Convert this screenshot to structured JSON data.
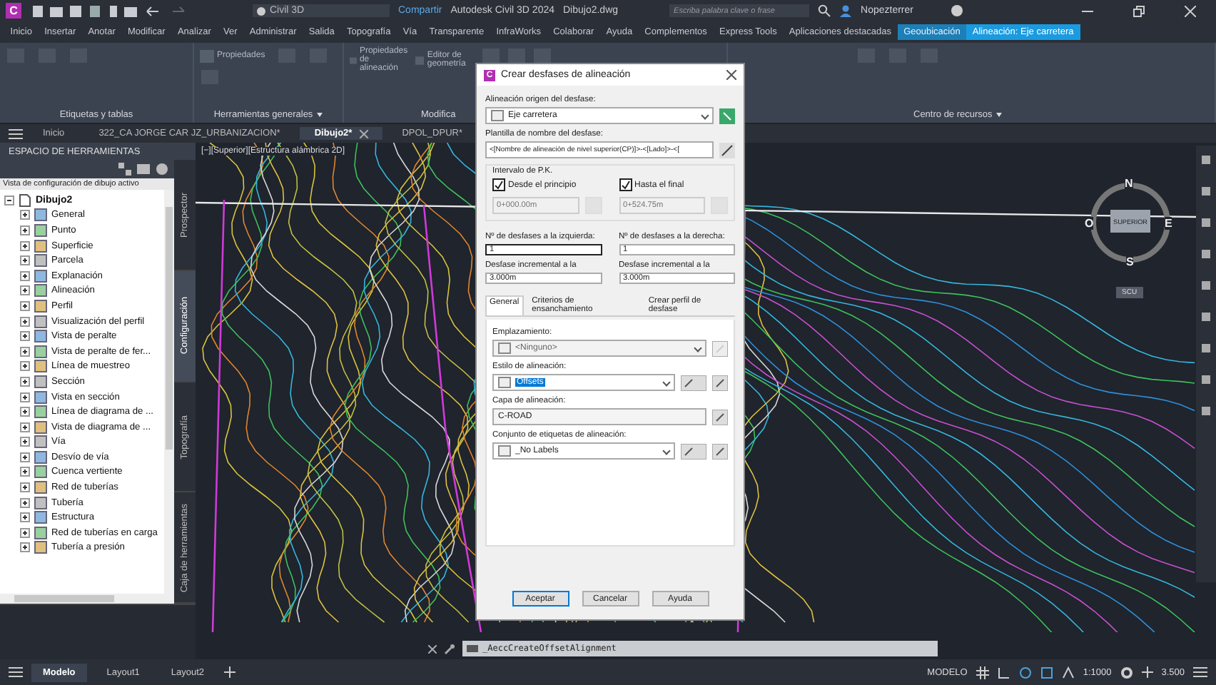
{
  "title_bar": {
    "app_letter": "C",
    "workspace": "Civil 3D",
    "share": "Compartir",
    "app_title": "Autodesk Civil 3D 2024",
    "file": "Dibujo2.dwg",
    "search": {
      "placeholder": "Escriba palabra clave o frase"
    },
    "user": "Nopezterrer"
  },
  "menu_tabs": [
    {
      "label": "Inicio",
      "kind": "normal",
      "selected": false
    },
    {
      "label": "Insertar",
      "kind": "normal",
      "selected": false
    },
    {
      "label": "Anotar",
      "kind": "normal",
      "selected": false
    },
    {
      "label": "Modificar",
      "kind": "normal",
      "selected": false
    },
    {
      "label": "Analizar",
      "kind": "normal",
      "selected": false
    },
    {
      "label": "Ver",
      "kind": "normal",
      "selected": false
    },
    {
      "label": "Administrar",
      "kind": "normal",
      "selected": false
    },
    {
      "label": "Salida",
      "kind": "normal",
      "selected": false
    },
    {
      "label": "Topografía",
      "kind": "normal",
      "selected": false
    },
    {
      "label": "Vía",
      "kind": "normal",
      "selected": false
    },
    {
      "label": "Transparente",
      "kind": "normal",
      "selected": false
    },
    {
      "label": "InfraWorks",
      "kind": "normal",
      "selected": false
    },
    {
      "label": "Colaborar",
      "kind": "normal",
      "selected": false
    },
    {
      "label": "Ayuda",
      "kind": "normal",
      "selected": false
    },
    {
      "label": "Complementos",
      "kind": "normal",
      "selected": false
    },
    {
      "label": "Express Tools",
      "kind": "normal",
      "selected": false
    },
    {
      "label": "Aplicaciones destacadas",
      "kind": "normal",
      "selected": false
    },
    {
      "label": "Geoubicación",
      "kind": "contextual",
      "selected": false
    },
    {
      "label": "Alineación: Eje carretera",
      "kind": "contextual",
      "selected": true
    }
  ],
  "ribbon": {
    "panels": [
      {
        "label": "Etiquetas y tablas",
        "menu": false
      },
      {
        "label": "Herramientas generales",
        "menu": true,
        "buttons": [
          "Propiedades"
        ]
      },
      {
        "label": "Modifica",
        "menu": false,
        "buttons": [
          "Propiedades de alineación",
          "Editor de geometría"
        ]
      },
      {
        "label": "Centro de recursos",
        "menu": true
      }
    ]
  },
  "doc_tabs": [
    {
      "label": "Inicio",
      "selected": false
    },
    {
      "label": "322_CA JORGE CAR JZ_URBANIZACION*",
      "selected": false
    },
    {
      "label": "Dibujo2*",
      "selected": true
    },
    {
      "label": "DPOL_DPUR*",
      "selected": false
    }
  ],
  "palette": {
    "title": "ESPACIO DE HERRAMIENTAS",
    "view": "Vista de configuración de dibujo activo",
    "tree": {
      "label": "Dibujo2",
      "expanded": true,
      "children": [
        {
          "label": "General",
          "expanded": false
        },
        {
          "label": "Punto",
          "expanded": false
        },
        {
          "label": "Superficie",
          "expanded": false
        },
        {
          "label": "Parcela",
          "expanded": false
        },
        {
          "label": "Explanación",
          "expanded": false
        },
        {
          "label": "Alineación",
          "expanded": false
        },
        {
          "label": "Perfil",
          "expanded": false
        },
        {
          "label": "Visualización del perfil",
          "expanded": false
        },
        {
          "label": "Vista de peralte",
          "expanded": false
        },
        {
          "label": "Vista de peralte de fer...",
          "expanded": false
        },
        {
          "label": "Línea de muestreo",
          "expanded": false
        },
        {
          "label": "Sección",
          "expanded": false
        },
        {
          "label": "Vista en sección",
          "expanded": false
        },
        {
          "label": "Línea de diagrama de ...",
          "expanded": false
        },
        {
          "label": "Vista de diagrama de ...",
          "expanded": false
        },
        {
          "label": "Vía",
          "expanded": false
        },
        {
          "label": "Desvío de vía",
          "expanded": false
        },
        {
          "label": "Cuenca vertiente",
          "expanded": false
        },
        {
          "label": "Red de tuberías",
          "expanded": false
        },
        {
          "label": "Tubería",
          "expanded": false
        },
        {
          "label": "Estructura",
          "expanded": false
        },
        {
          "label": "Red de tuberías en carga",
          "expanded": false
        },
        {
          "label": "Tubería a presión",
          "expanded": false
        }
      ]
    },
    "side_tabs": [
      {
        "label": "Prospector",
        "selected": false
      },
      {
        "label": "Configuración",
        "selected": true
      },
      {
        "label": "Topografía",
        "selected": false
      },
      {
        "label": "Caja de herramientas",
        "selected": false
      }
    ]
  },
  "viewport": {
    "label": "[−][Superior][Estructura alámbrica 2D]",
    "compass": {
      "north": "N",
      "south": "S",
      "east": "E",
      "west": "O",
      "cube": "SUPERIOR",
      "ucs": "SCU"
    },
    "command": "_AeccCreateOffsetAlignment"
  },
  "dialog": {
    "logo_letter": "C",
    "title": "Crear desfases de alineación",
    "source_label": "Alineación origen del desfase:",
    "source_value": "Eje carretera",
    "template_label": "Plantilla de nombre del desfase:",
    "template_value": "<[Nombre de alineación de nivel superior(CP)]>-<[Lado]>-<[",
    "station_group": "Intervalo de P.K.",
    "stations": [
      {
        "label": "Desde el principio",
        "checked": true,
        "value": "0+000.00m"
      },
      {
        "label": "Hasta el final",
        "checked": true,
        "value": "0+524.75m"
      }
    ],
    "offsets": [
      {
        "label": "Nº de desfases a la izquierda:",
        "value": "1"
      },
      {
        "label": "Nº de desfases a la derecha:",
        "value": "1"
      },
      {
        "label": "Desfase incremental a la",
        "value": "3.000m"
      },
      {
        "label": "Desfase incremental a la",
        "value": "3.000m"
      }
    ],
    "tabs": [
      {
        "label": "General",
        "selected": true
      },
      {
        "label": "Criterios de ensanchamiento",
        "selected": false
      },
      {
        "label": "Crear perfil de desfase",
        "selected": false
      }
    ],
    "fields": [
      {
        "kind": "site",
        "label": "Emplazamiento:",
        "value": "<Ninguno>",
        "disabled": true,
        "text_selected": false
      },
      {
        "kind": "style",
        "label": "Estilo de alineación:",
        "value": "Offsets",
        "disabled": false,
        "text_selected": true
      },
      {
        "kind": "layer",
        "label": "Capa de alineación:",
        "value": "C-ROAD",
        "disabled": false,
        "text_selected": false
      },
      {
        "kind": "labels",
        "label": "Conjunto de etiquetas de alineación:",
        "value": "_No Labels",
        "disabled": false,
        "text_selected": false
      }
    ],
    "buttons": [
      {
        "label": "Aceptar",
        "default": true
      },
      {
        "label": "Cancelar",
        "default": false
      },
      {
        "label": "Ayuda",
        "default": false
      }
    ]
  },
  "status_bar": {
    "layouts": [
      {
        "label": "Modelo",
        "selected": true
      },
      {
        "label": "Layout1",
        "selected": false
      },
      {
        "label": "Layout2",
        "selected": false
      }
    ],
    "space": "MODELO",
    "scale": "1:1000",
    "value": "3.500"
  }
}
